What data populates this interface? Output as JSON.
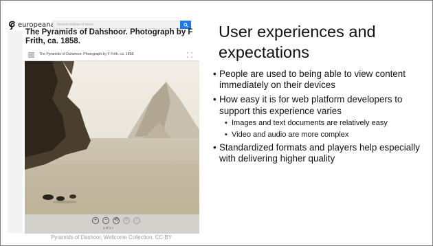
{
  "europeana": {
    "logo_text": "europeana",
    "search_placeholder": "Search millions of items",
    "item_title": "The Pyramids of Dahshoor. Photograph by F Frith, ca. 1858.",
    "viewer_caption": "The Pyramids of Dahshoor. Photograph by F Frith, ca. 1858.",
    "pager_text": "1 of 1 >",
    "accent": "#1f7ae0"
  },
  "credit": "Pyramids of Dashoor, Wellcome Collection, CC-BY",
  "slide": {
    "title": "User experiences and expectations",
    "bullets": [
      "People are used to being able to view content immediately on their devices",
      "How easy it is for web platform developers to support this experience varies",
      "Images and text documents are relatively easy",
      "Video and audio are more complex",
      "Standardized formats and players help especially with delivering higher quality"
    ]
  }
}
